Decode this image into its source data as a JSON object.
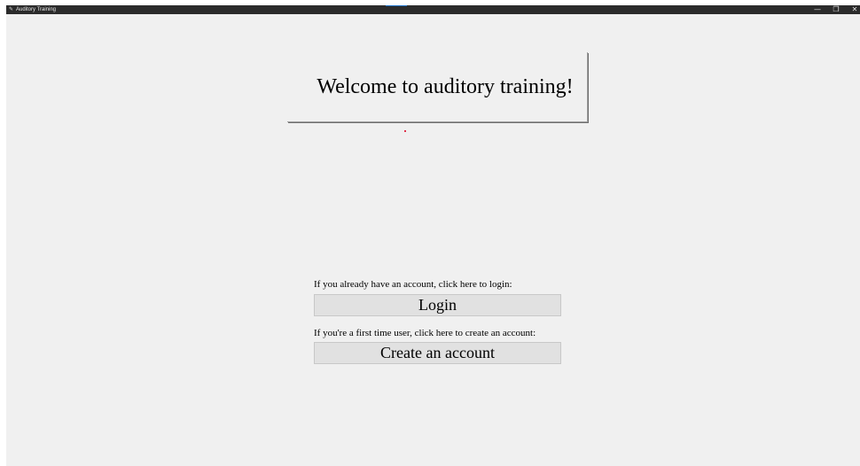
{
  "window": {
    "title": "Auditory Training",
    "app_icon": "feather-icon",
    "controls": {
      "minimize": "—",
      "maximize": "❐",
      "close": "✕"
    }
  },
  "welcome": {
    "text": "Welcome to auditory training!"
  },
  "login": {
    "prompt": "If you already have an account, click here to login:",
    "button_label": "Login"
  },
  "create": {
    "prompt": "If you're a first time user, click here to create an account:",
    "button_label": "Create an account"
  },
  "colors": {
    "titlebar": "#2b2b2b",
    "window_bg": "#f0f0f0",
    "button_bg": "#e1e1e1",
    "accent": "#1e6fc4"
  }
}
